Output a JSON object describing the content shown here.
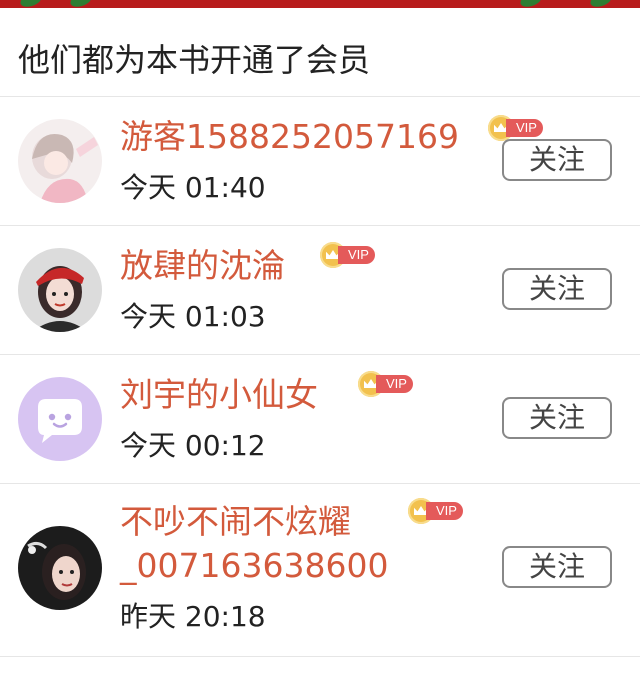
{
  "header": {
    "title": "他们都为本书开通了会员"
  },
  "members": [
    {
      "name": "游客1588252057169",
      "time": "今天 01:40",
      "vip": "VIP",
      "follow_label": "关注"
    },
    {
      "name": "放肆的沈淪",
      "time": "今天 01:03",
      "vip": "VIP",
      "follow_label": "关注"
    },
    {
      "name": "刘宇的小仙女",
      "time": "今天 00:12",
      "vip": "VIP",
      "follow_label": "关注"
    },
    {
      "name": "不吵不闹不炫耀_007163638600",
      "time": "昨天 20:18",
      "vip": "VIP",
      "follow_label": "关注"
    }
  ],
  "colors": {
    "name": "#d35a3c",
    "vip_badge": "#e45a5a",
    "crown": "#f2c14e",
    "banner": "#b81c1c"
  }
}
